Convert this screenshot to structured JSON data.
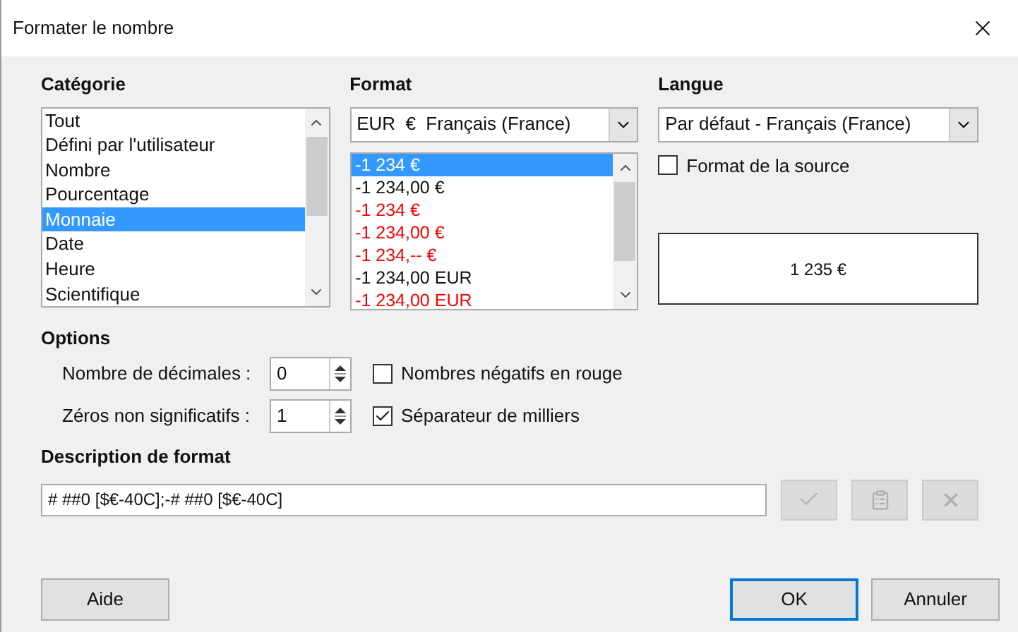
{
  "window": {
    "title": "Formater le nombre"
  },
  "category": {
    "label": "Catégorie",
    "items": [
      {
        "label": "Tout",
        "selected": false
      },
      {
        "label": "Défini par l'utilisateur",
        "selected": false
      },
      {
        "label": "Nombre",
        "selected": false
      },
      {
        "label": "Pourcentage",
        "selected": false
      },
      {
        "label": "Monnaie",
        "selected": true
      },
      {
        "label": "Date",
        "selected": false
      },
      {
        "label": "Heure",
        "selected": false
      },
      {
        "label": "Scientifique",
        "selected": false
      }
    ]
  },
  "format": {
    "label": "Format",
    "currency": "EUR  €  Français (France)",
    "items": [
      {
        "label": "-1 234 €",
        "selected": true
      },
      {
        "label": "-1 234,00 €",
        "negative_red": false,
        "selected": false
      },
      {
        "label": "-1 234 €",
        "negative_red": true,
        "selected": false
      },
      {
        "label": "-1 234,00 €",
        "negative_red": true,
        "selected": false
      },
      {
        "label": "-1 234,-- €",
        "negative_red": true,
        "selected": false
      },
      {
        "label": "-1 234,00 EUR",
        "negative_red": false,
        "selected": false
      },
      {
        "label": "-1 234,00 EUR",
        "negative_red": true,
        "selected": false
      }
    ]
  },
  "language": {
    "label": "Langue",
    "value": "Par défaut - Français (France)",
    "source_format": {
      "label": "Format de la source",
      "checked": false
    },
    "preview": "1 235 €"
  },
  "options": {
    "label": "Options",
    "decimals": {
      "label": "Nombre de décimales :",
      "value": "0"
    },
    "leading_zeros": {
      "label": "Zéros non significatifs :",
      "value": "1"
    },
    "negative_red": {
      "label": "Nombres négatifs en rouge",
      "checked": false
    },
    "thousands_separator": {
      "label": "Séparateur de milliers",
      "checked": true
    }
  },
  "format_code": {
    "label": "Description de format",
    "value": "# ##0 [$€-40C];-# ##0 [$€-40C]"
  },
  "buttons": {
    "help": "Aide",
    "ok": "OK",
    "cancel": "Annuler"
  }
}
